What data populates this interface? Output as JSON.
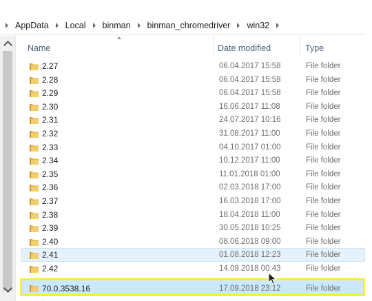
{
  "breadcrumb": [
    "AppData",
    "Local",
    "binman",
    "binman_chromedriver",
    "win32"
  ],
  "columns": {
    "name": "Name",
    "date": "Date modified",
    "type": "Type"
  },
  "rows": [
    {
      "name": "2.27",
      "date": "06.04.2017 15:58",
      "type": "File folder"
    },
    {
      "name": "2.28",
      "date": "06.04.2017 15:58",
      "type": "File folder"
    },
    {
      "name": "2.29",
      "date": "06.04.2017 15:58",
      "type": "File folder"
    },
    {
      "name": "2.30",
      "date": "16.06.2017 11:08",
      "type": "File folder"
    },
    {
      "name": "2.31",
      "date": "24.07.2017 10:16",
      "type": "File folder"
    },
    {
      "name": "2.32",
      "date": "31.08.2017 11:00",
      "type": "File folder"
    },
    {
      "name": "2.33",
      "date": "04.10.2017 01:00",
      "type": "File folder"
    },
    {
      "name": "2.34",
      "date": "10.12.2017 11:00",
      "type": "File folder"
    },
    {
      "name": "2.35",
      "date": "11.01.2018 01:00",
      "type": "File folder"
    },
    {
      "name": "2.36",
      "date": "02.03.2018 17:00",
      "type": "File folder"
    },
    {
      "name": "2.37",
      "date": "16.03.2018 17:00",
      "type": "File folder"
    },
    {
      "name": "2.38",
      "date": "18.04.2018 11:00",
      "type": "File folder"
    },
    {
      "name": "2.39",
      "date": "30.05.2018 10:25",
      "type": "File folder"
    },
    {
      "name": "2.40",
      "date": "08.06.2018 09:00",
      "type": "File folder"
    },
    {
      "name": "2.41",
      "date": "01.08.2018 12:23",
      "type": "File folder"
    },
    {
      "name": "2.42",
      "date": "14.09.2018 00:43",
      "type": "File folder"
    },
    {
      "name": "70.0.3538.16",
      "date": "17.09.2018 23:12",
      "type": "File folder"
    }
  ],
  "colors": {
    "folder": "#e8b84a",
    "selection": "#cce8ff",
    "highlight_border": "#f6ef3a"
  },
  "icons": {
    "folder": "folder-icon",
    "up": "chevron-up-icon",
    "down": "chevron-down-icon"
  }
}
